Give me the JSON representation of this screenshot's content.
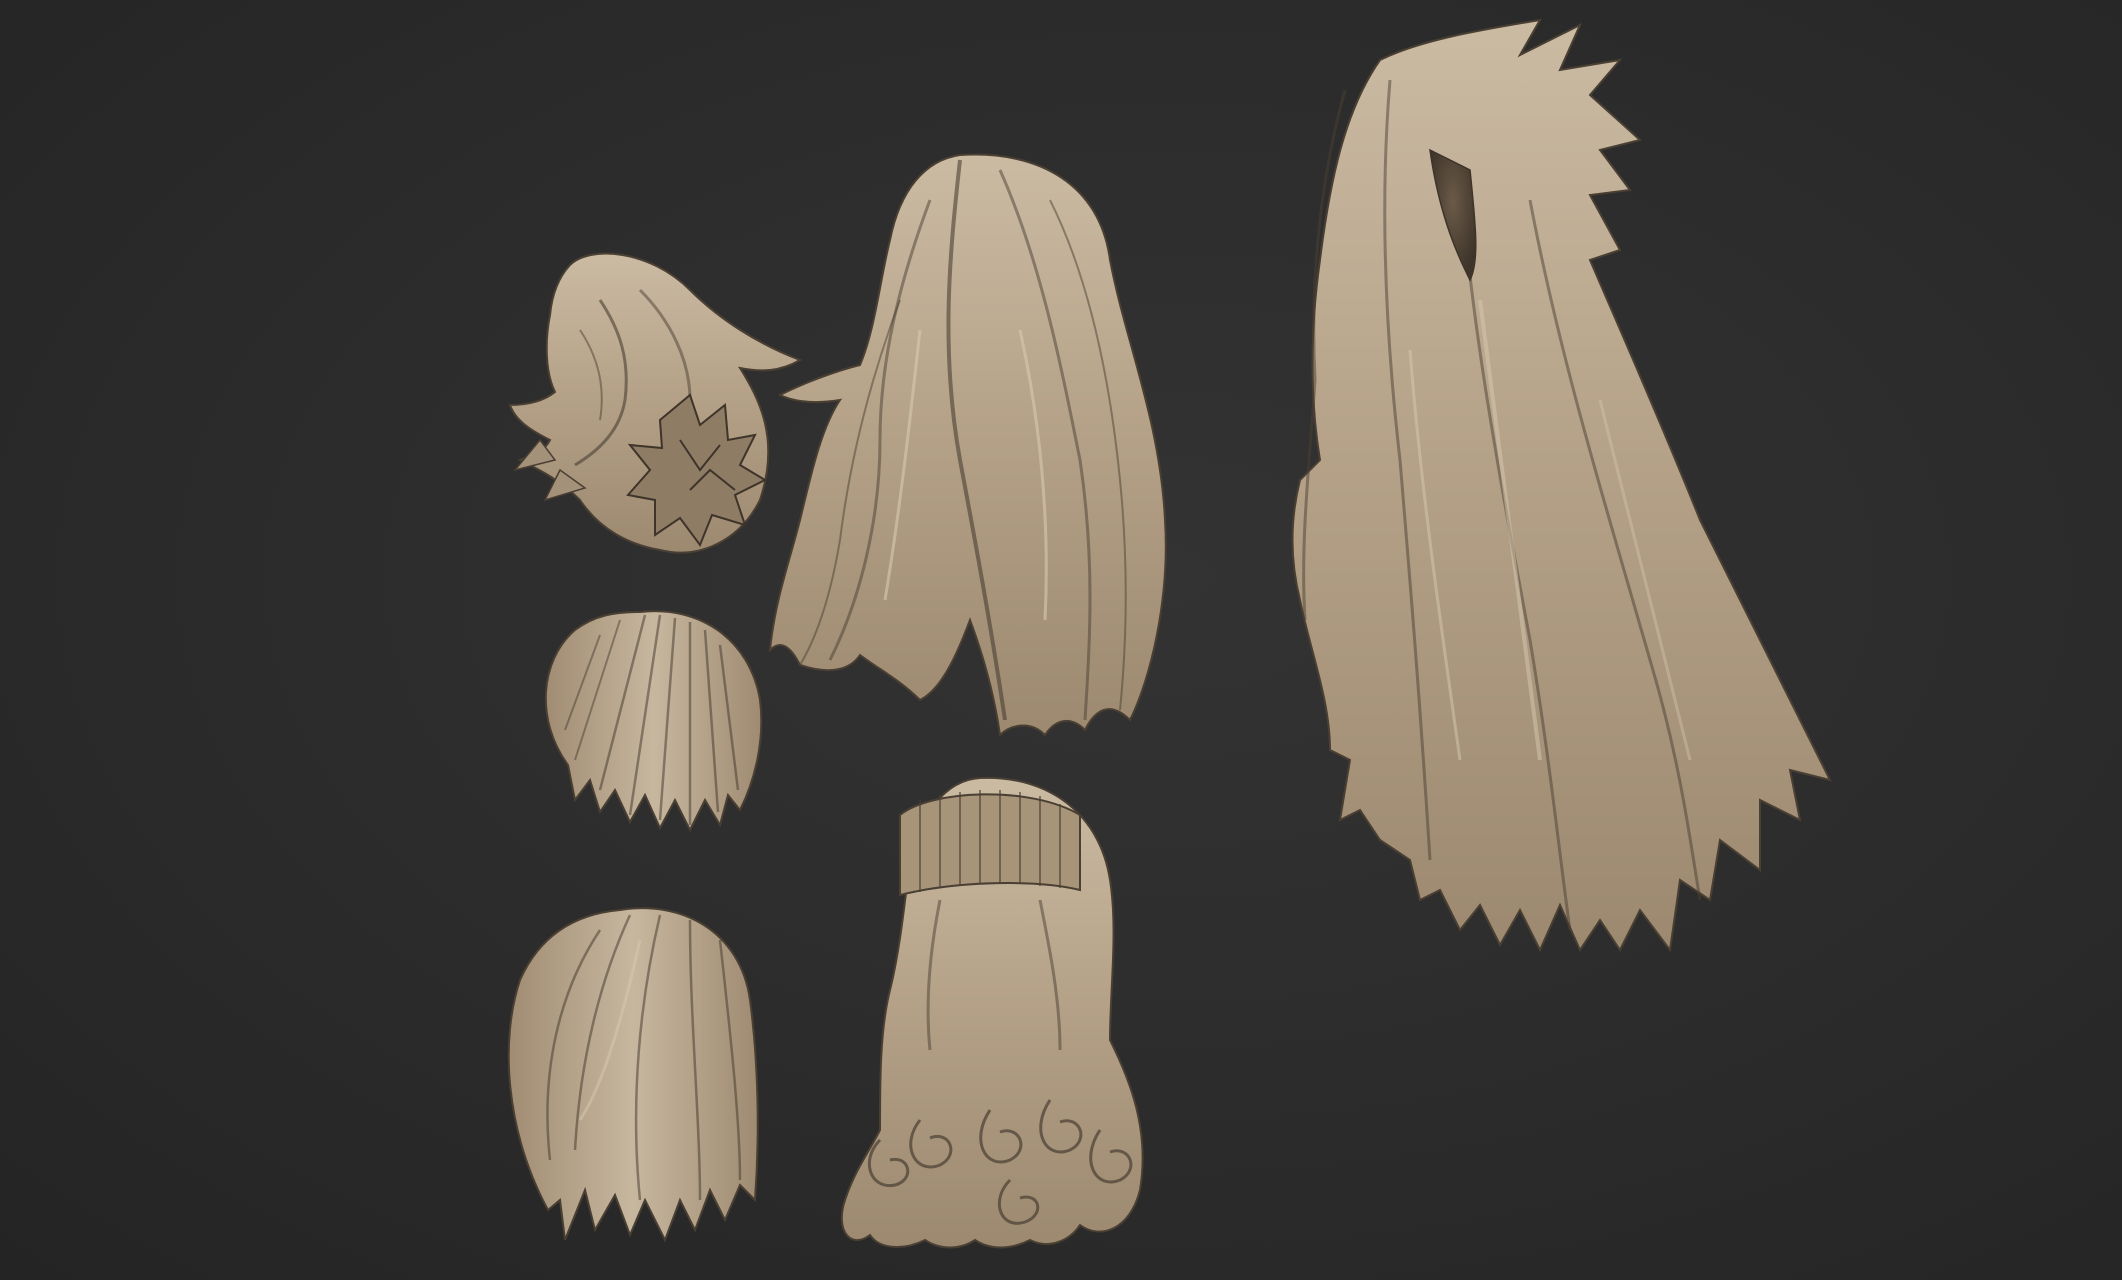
{
  "scene": {
    "background_color": "#2b2b2b",
    "material_color": "#b9a78f",
    "shadow_color": "#4a3f33",
    "highlight_color": "#d8c9b2"
  },
  "models": [
    {
      "name": "spiky-updo-hair-model"
    },
    {
      "name": "long-swept-hair-model"
    },
    {
      "name": "very-long-spiky-hair-model"
    },
    {
      "name": "short-bob-hair-model"
    },
    {
      "name": "medium-layered-hair-model"
    },
    {
      "name": "curly-hime-cut-hair-model"
    }
  ]
}
